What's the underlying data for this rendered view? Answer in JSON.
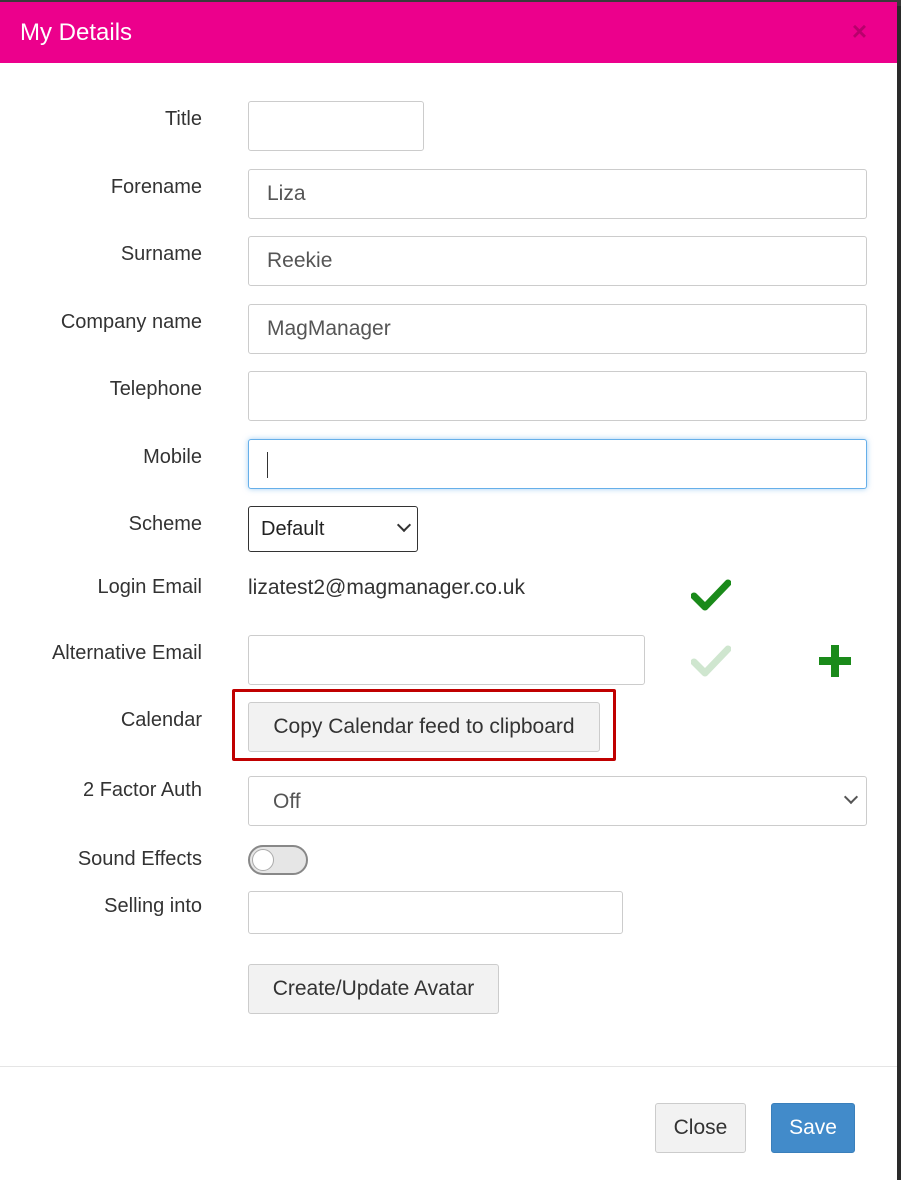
{
  "dialog": {
    "title": "My Details",
    "close_icon": "×"
  },
  "fields": {
    "title": {
      "label": "Title",
      "value": ""
    },
    "forename": {
      "label": "Forename",
      "value": "Liza"
    },
    "surname": {
      "label": "Surname",
      "value": "Reekie"
    },
    "company": {
      "label": "Company name",
      "value": "MagManager"
    },
    "telephone": {
      "label": "Telephone",
      "value": ""
    },
    "mobile": {
      "label": "Mobile",
      "value": ""
    },
    "scheme": {
      "label": "Scheme",
      "selected": "Default"
    },
    "login_email": {
      "label": "Login Email",
      "value": "lizatest2@magmanager.co.uk"
    },
    "alt_email": {
      "label": "Alternative Email",
      "value": ""
    },
    "calendar": {
      "label": "Calendar",
      "button_label": "Copy Calendar feed to clipboard"
    },
    "two_factor": {
      "label": "2 Factor Auth",
      "selected": "Off"
    },
    "sound_effects": {
      "label": "Sound Effects",
      "enabled": false
    },
    "selling_into": {
      "label": "Selling into",
      "value": ""
    }
  },
  "avatar_button_label": "Create/Update Avatar",
  "footer": {
    "close_label": "Close",
    "save_label": "Save"
  },
  "colors": {
    "header": "#ec008c",
    "check_active": "#1a8a1a",
    "check_inactive": "#cfe6cf",
    "primary": "#428bca",
    "highlight": "#c00000"
  },
  "icons": {
    "login_email_status": "check-icon",
    "alt_email_status": "check-icon",
    "alt_email_add": "plus-icon"
  }
}
